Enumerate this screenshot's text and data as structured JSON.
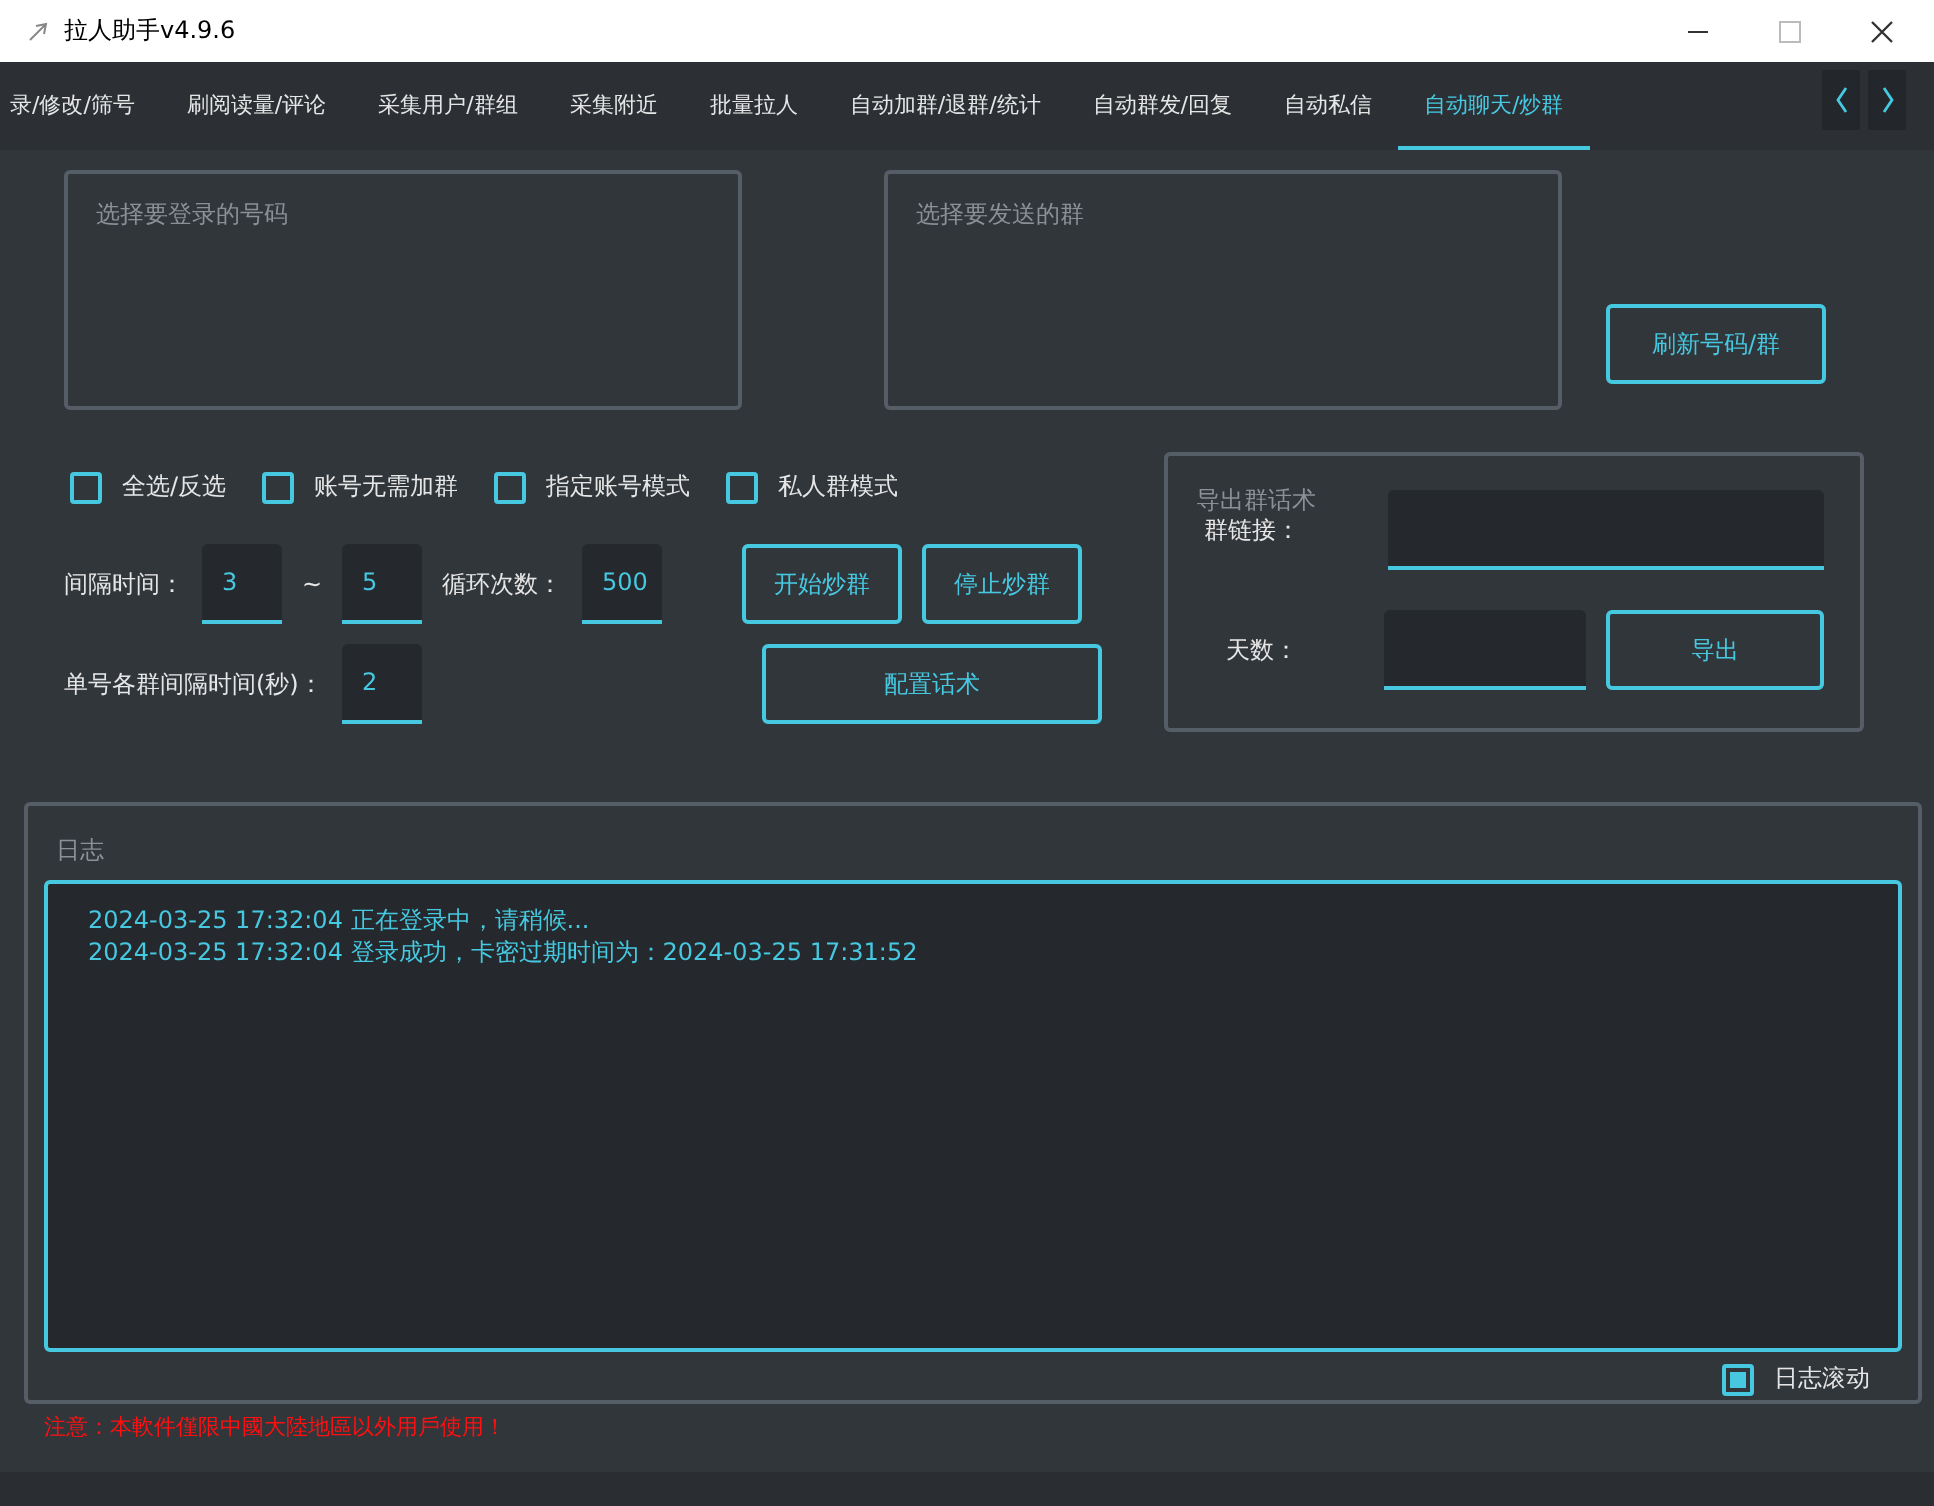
{
  "window": {
    "title": "拉人助手v4.9.6"
  },
  "tabs": [
    {
      "label": "录/修改/筛号",
      "selected": false
    },
    {
      "label": "刷阅读量/评论",
      "selected": false
    },
    {
      "label": "采集用户/群组",
      "selected": false
    },
    {
      "label": "采集附近",
      "selected": false
    },
    {
      "label": "批量拉人",
      "selected": false
    },
    {
      "label": "自动加群/退群/统计",
      "selected": false
    },
    {
      "label": "自动群发/回复",
      "selected": false
    },
    {
      "label": "自动私信",
      "selected": false
    },
    {
      "label": "自动聊天/炒群",
      "selected": true
    }
  ],
  "account_list": {
    "title": "选择要登录的号码"
  },
  "group_list": {
    "title": "选择要发送的群"
  },
  "refresh_button": "刷新号码/群",
  "options": [
    {
      "label": "全选/反选",
      "checked": false
    },
    {
      "label": "账号无需加群",
      "checked": false
    },
    {
      "label": "指定账号模式",
      "checked": false
    },
    {
      "label": "私人群模式",
      "checked": false
    }
  ],
  "interval": {
    "label": "间隔时间：",
    "min": "3",
    "separator": "~",
    "max": "5"
  },
  "loop": {
    "label": "循环次数：",
    "value": "500"
  },
  "per_group": {
    "label": "单号各群间隔时间(秒)：",
    "value": "2"
  },
  "buttons": {
    "start": "开始炒群",
    "stop": "停止炒群",
    "config": "配置话术"
  },
  "export": {
    "title": "导出群话术",
    "link_label": "群链接：",
    "days_label": "天数：",
    "button": "导出"
  },
  "log": {
    "title": "日志",
    "lines": [
      "2024-03-25 17:32:04 正在登录中，请稍候...",
      "2024-03-25 17:32:04 登录成功，卡密过期时间为：2024-03-25 17:31:52"
    ],
    "autoscroll": {
      "label": "日志滚动",
      "checked": true
    }
  },
  "notice": "注意：本軟件僅限中國大陸地區以外用戶使用！"
}
